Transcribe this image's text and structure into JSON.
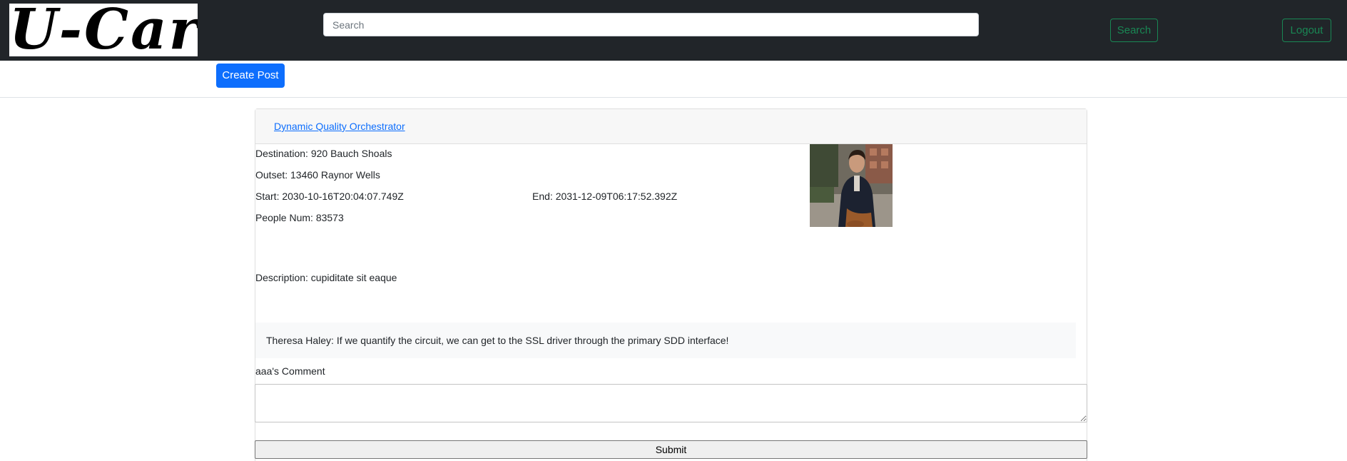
{
  "navbar": {
    "logo_text": "U-Car",
    "search_placeholder": "Search",
    "search_button": "Search",
    "logout_button": "Logout"
  },
  "toolbar": {
    "create_post_label": "Create Post"
  },
  "post": {
    "title": "Dynamic Quality Orchestrator",
    "destination": "Destination: 920 Bauch Shoals",
    "outset": "Outset: 13460 Raynor Wells",
    "start": "Start: 2030-10-16T20:04:07.749Z",
    "end": "End: 2031-12-09T06:17:52.392Z",
    "people_num": "People Num: 83573",
    "description": "Description: cupiditate sit eaque",
    "comments": [
      {
        "text": "Theresa Haley: If we quantify the circuit, we can get to the SSL driver through the primary SDD interface!"
      }
    ],
    "comment_label": "aaa's Comment",
    "comment_value": "",
    "submit_label": "Submit"
  },
  "colors": {
    "navbar_bg": "#212529",
    "accent_green": "#198754",
    "primary_blue": "#0d6efd"
  }
}
